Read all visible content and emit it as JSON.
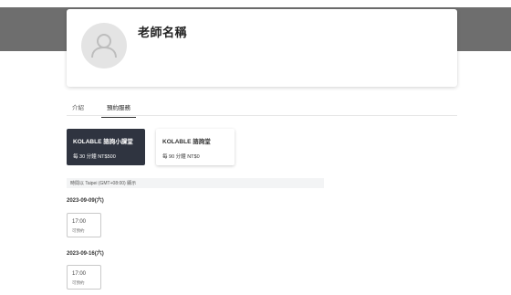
{
  "profile": {
    "name": "老師名稱",
    "avatar_icon": "user-avatar-icon"
  },
  "tabs": [
    {
      "label": "介紹",
      "active": false
    },
    {
      "label": "預約服務",
      "active": true
    }
  ],
  "services": [
    {
      "title": "KOLABLE 諮詢小課堂",
      "price": "每 30 分鐘 NT$500",
      "selected": true
    },
    {
      "title": "KOLABLE 諮詢堂",
      "price": "每 90 分鐘 NT$0",
      "selected": false
    }
  ],
  "timezone_note": "時間以 Taipei (GMT+08:00) 顯示",
  "schedule": [
    {
      "date": "2023-09-09(六)",
      "slots": [
        {
          "time": "17:00",
          "status": "可預約"
        }
      ]
    },
    {
      "date": "2023-09-16(六)",
      "slots": [
        {
          "time": "17:00",
          "status": "可預約"
        }
      ]
    }
  ],
  "colors": {
    "hero_background": "#6e6e6e",
    "selected_card": "#2f3440",
    "timezone_bar": "#f3f4f5"
  }
}
